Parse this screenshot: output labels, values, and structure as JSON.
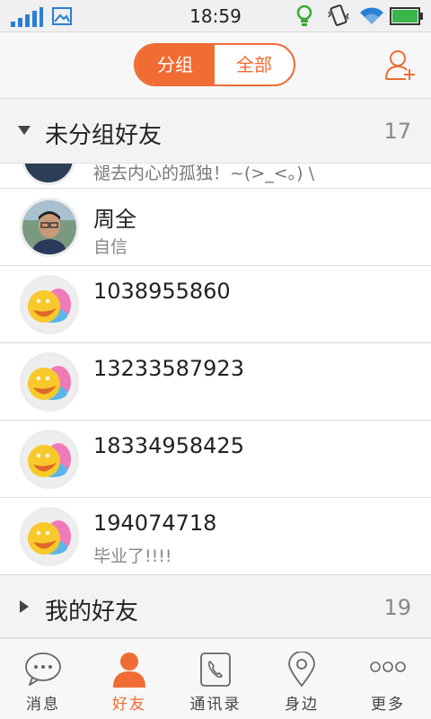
{
  "status_bar": {
    "time": "18:59"
  },
  "header": {
    "segments": [
      "分组",
      "全部"
    ],
    "active_segment": "分组"
  },
  "groups": [
    {
      "name": "未分组好友",
      "count": "17",
      "expanded": true
    },
    {
      "name": "我的好友",
      "count": "19",
      "expanded": false
    }
  ],
  "partial_row": {
    "signature": "褪去内心的孤独！~(>_<。) \\"
  },
  "friends": [
    {
      "nickname": "周全",
      "signature": "自信",
      "avatar": "photo-avatar"
    },
    {
      "nickname": "1038955860",
      "signature": "",
      "avatar": "default-qq-avatar"
    },
    {
      "nickname": "13233587923",
      "signature": "",
      "avatar": "default-qq-avatar"
    },
    {
      "nickname": "18334958425",
      "signature": "",
      "avatar": "default-qq-avatar"
    },
    {
      "nickname": "194074718",
      "signature": "毕业了!!!!",
      "avatar": "default-qq-avatar"
    }
  ],
  "tabs": [
    {
      "label": "消息",
      "icon": "chat-bubble-icon"
    },
    {
      "label": "好友",
      "icon": "person-icon"
    },
    {
      "label": "通讯录",
      "icon": "phone-book-icon"
    },
    {
      "label": "身边",
      "icon": "location-pin-icon"
    },
    {
      "label": "更多",
      "icon": "more-dots-icon"
    }
  ],
  "active_tab": "好友",
  "colors": {
    "accent": "#f06c33",
    "wifi": "#2a7fd6",
    "battery": "#39b54a"
  }
}
